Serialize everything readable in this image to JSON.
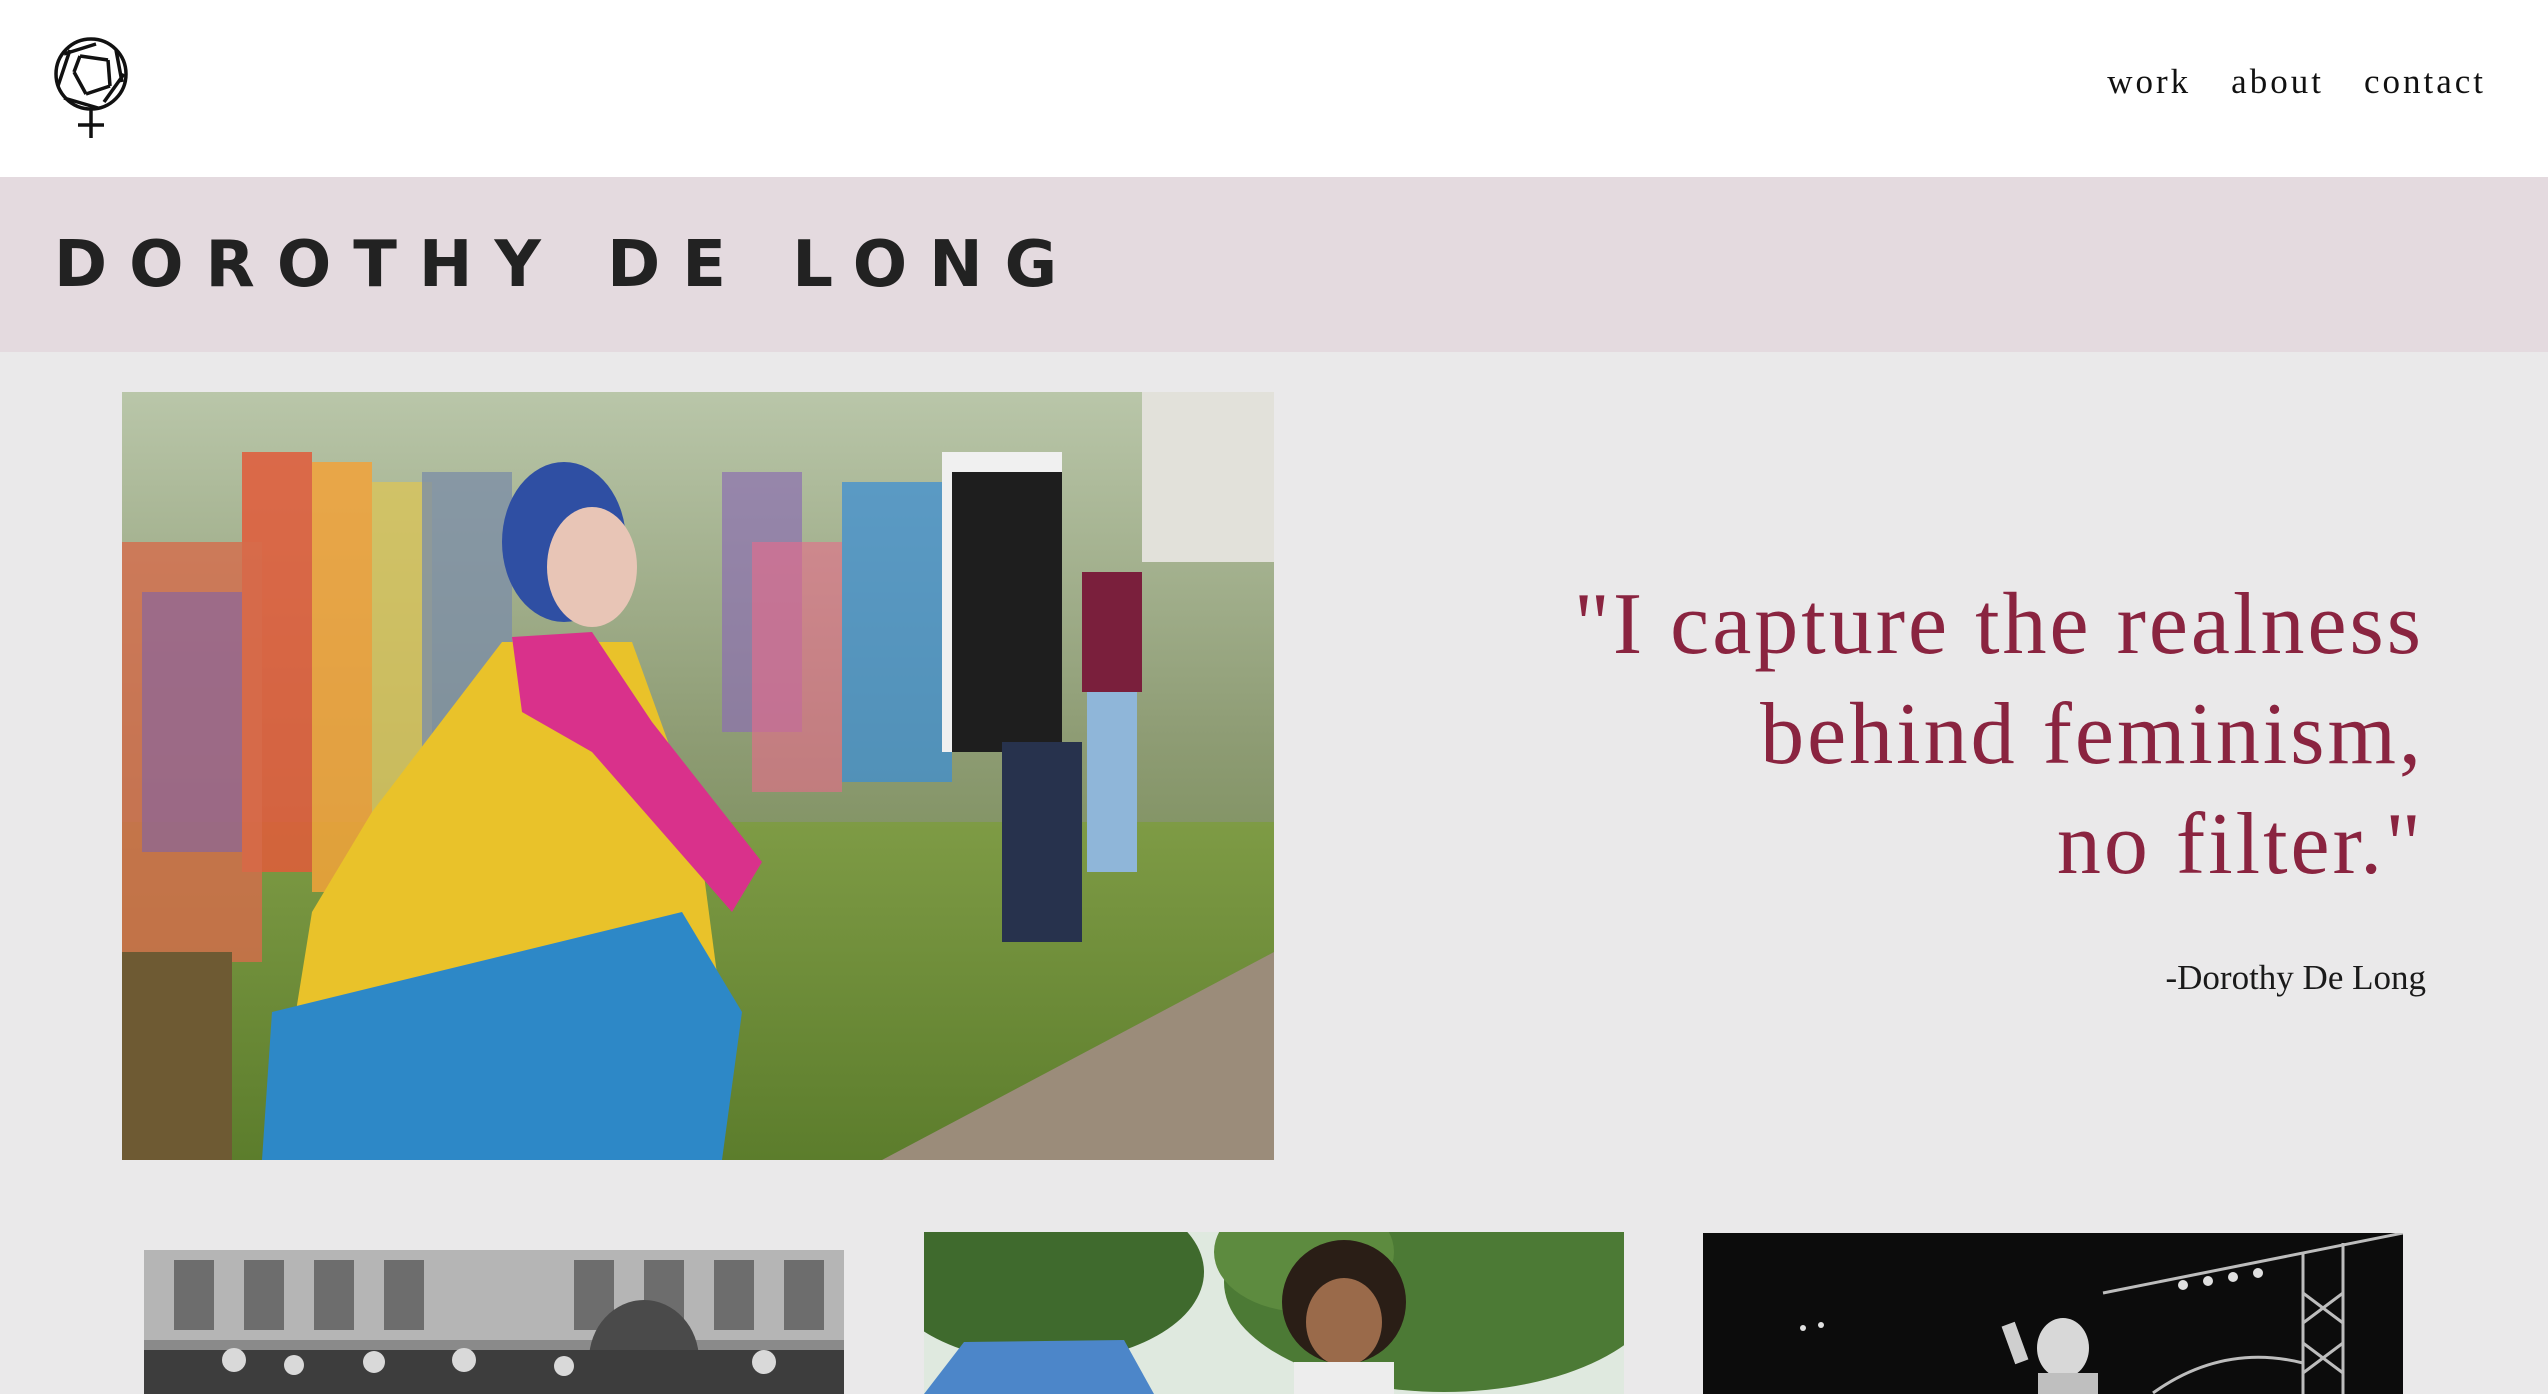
{
  "header": {
    "logo_icon": "aperture-venus-icon",
    "nav": [
      {
        "label": "work"
      },
      {
        "label": "about"
      },
      {
        "label": "contact"
      }
    ]
  },
  "banner": {
    "title": "DOROTHY DE LONG",
    "background": "#e4dadf"
  },
  "hero": {
    "photo_icon": "pride-march-photo"
  },
  "quote": {
    "lines": [
      "\"I capture the realness",
      "behind feminism,",
      "no filter.\""
    ],
    "attribution": "-Dorothy De Long",
    "color": "#8a2440"
  },
  "gallery": [
    {
      "icon": "street-crowd-photo"
    },
    {
      "icon": "child-outdoors-photo"
    },
    {
      "icon": "stage-performer-photo"
    }
  ]
}
